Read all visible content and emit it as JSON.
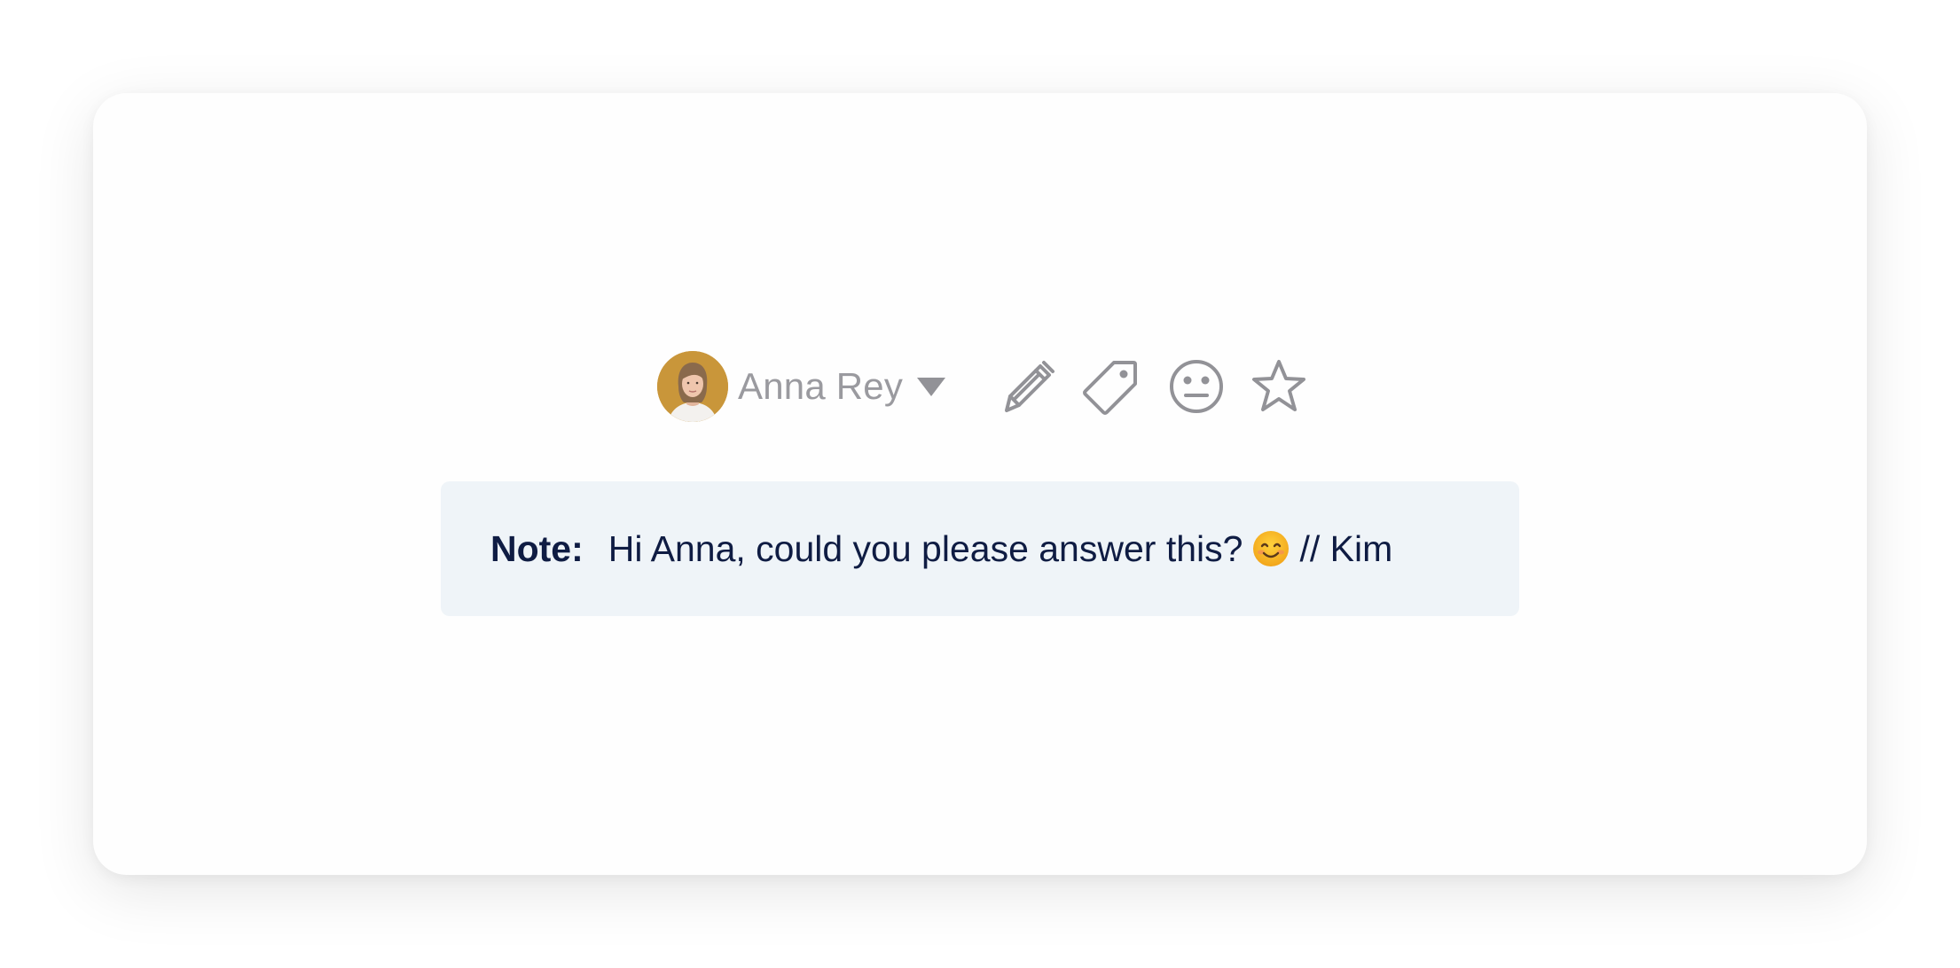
{
  "assignee": {
    "name": "Anna Rey",
    "avatar_color": "#c9963a"
  },
  "toolbar": {
    "icons": [
      "pencil-icon",
      "tag-icon",
      "neutral-face-icon",
      "star-icon"
    ],
    "icon_color": "#929297"
  },
  "note": {
    "label": "Note:",
    "text_before_emoji": "Hi Anna, could you please answer this?",
    "emoji": "smiling-face-emoji",
    "text_after_emoji": "// Kim",
    "background": "#eff4f8",
    "text_color": "#0f1c43"
  }
}
